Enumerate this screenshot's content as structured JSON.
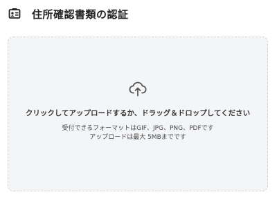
{
  "header": {
    "icon": "id-card-icon",
    "title": "住所確認書類の認証"
  },
  "dropzone": {
    "icon": "cloud-upload-icon",
    "primary_text": "クリックしてアップロードするか、ドラッグ＆ドロップしてください",
    "formats_text": "受付できるフォーマットはGIF、JPG、PNG、PDFです",
    "size_text": "アップロードは最大 5MBまでです"
  }
}
